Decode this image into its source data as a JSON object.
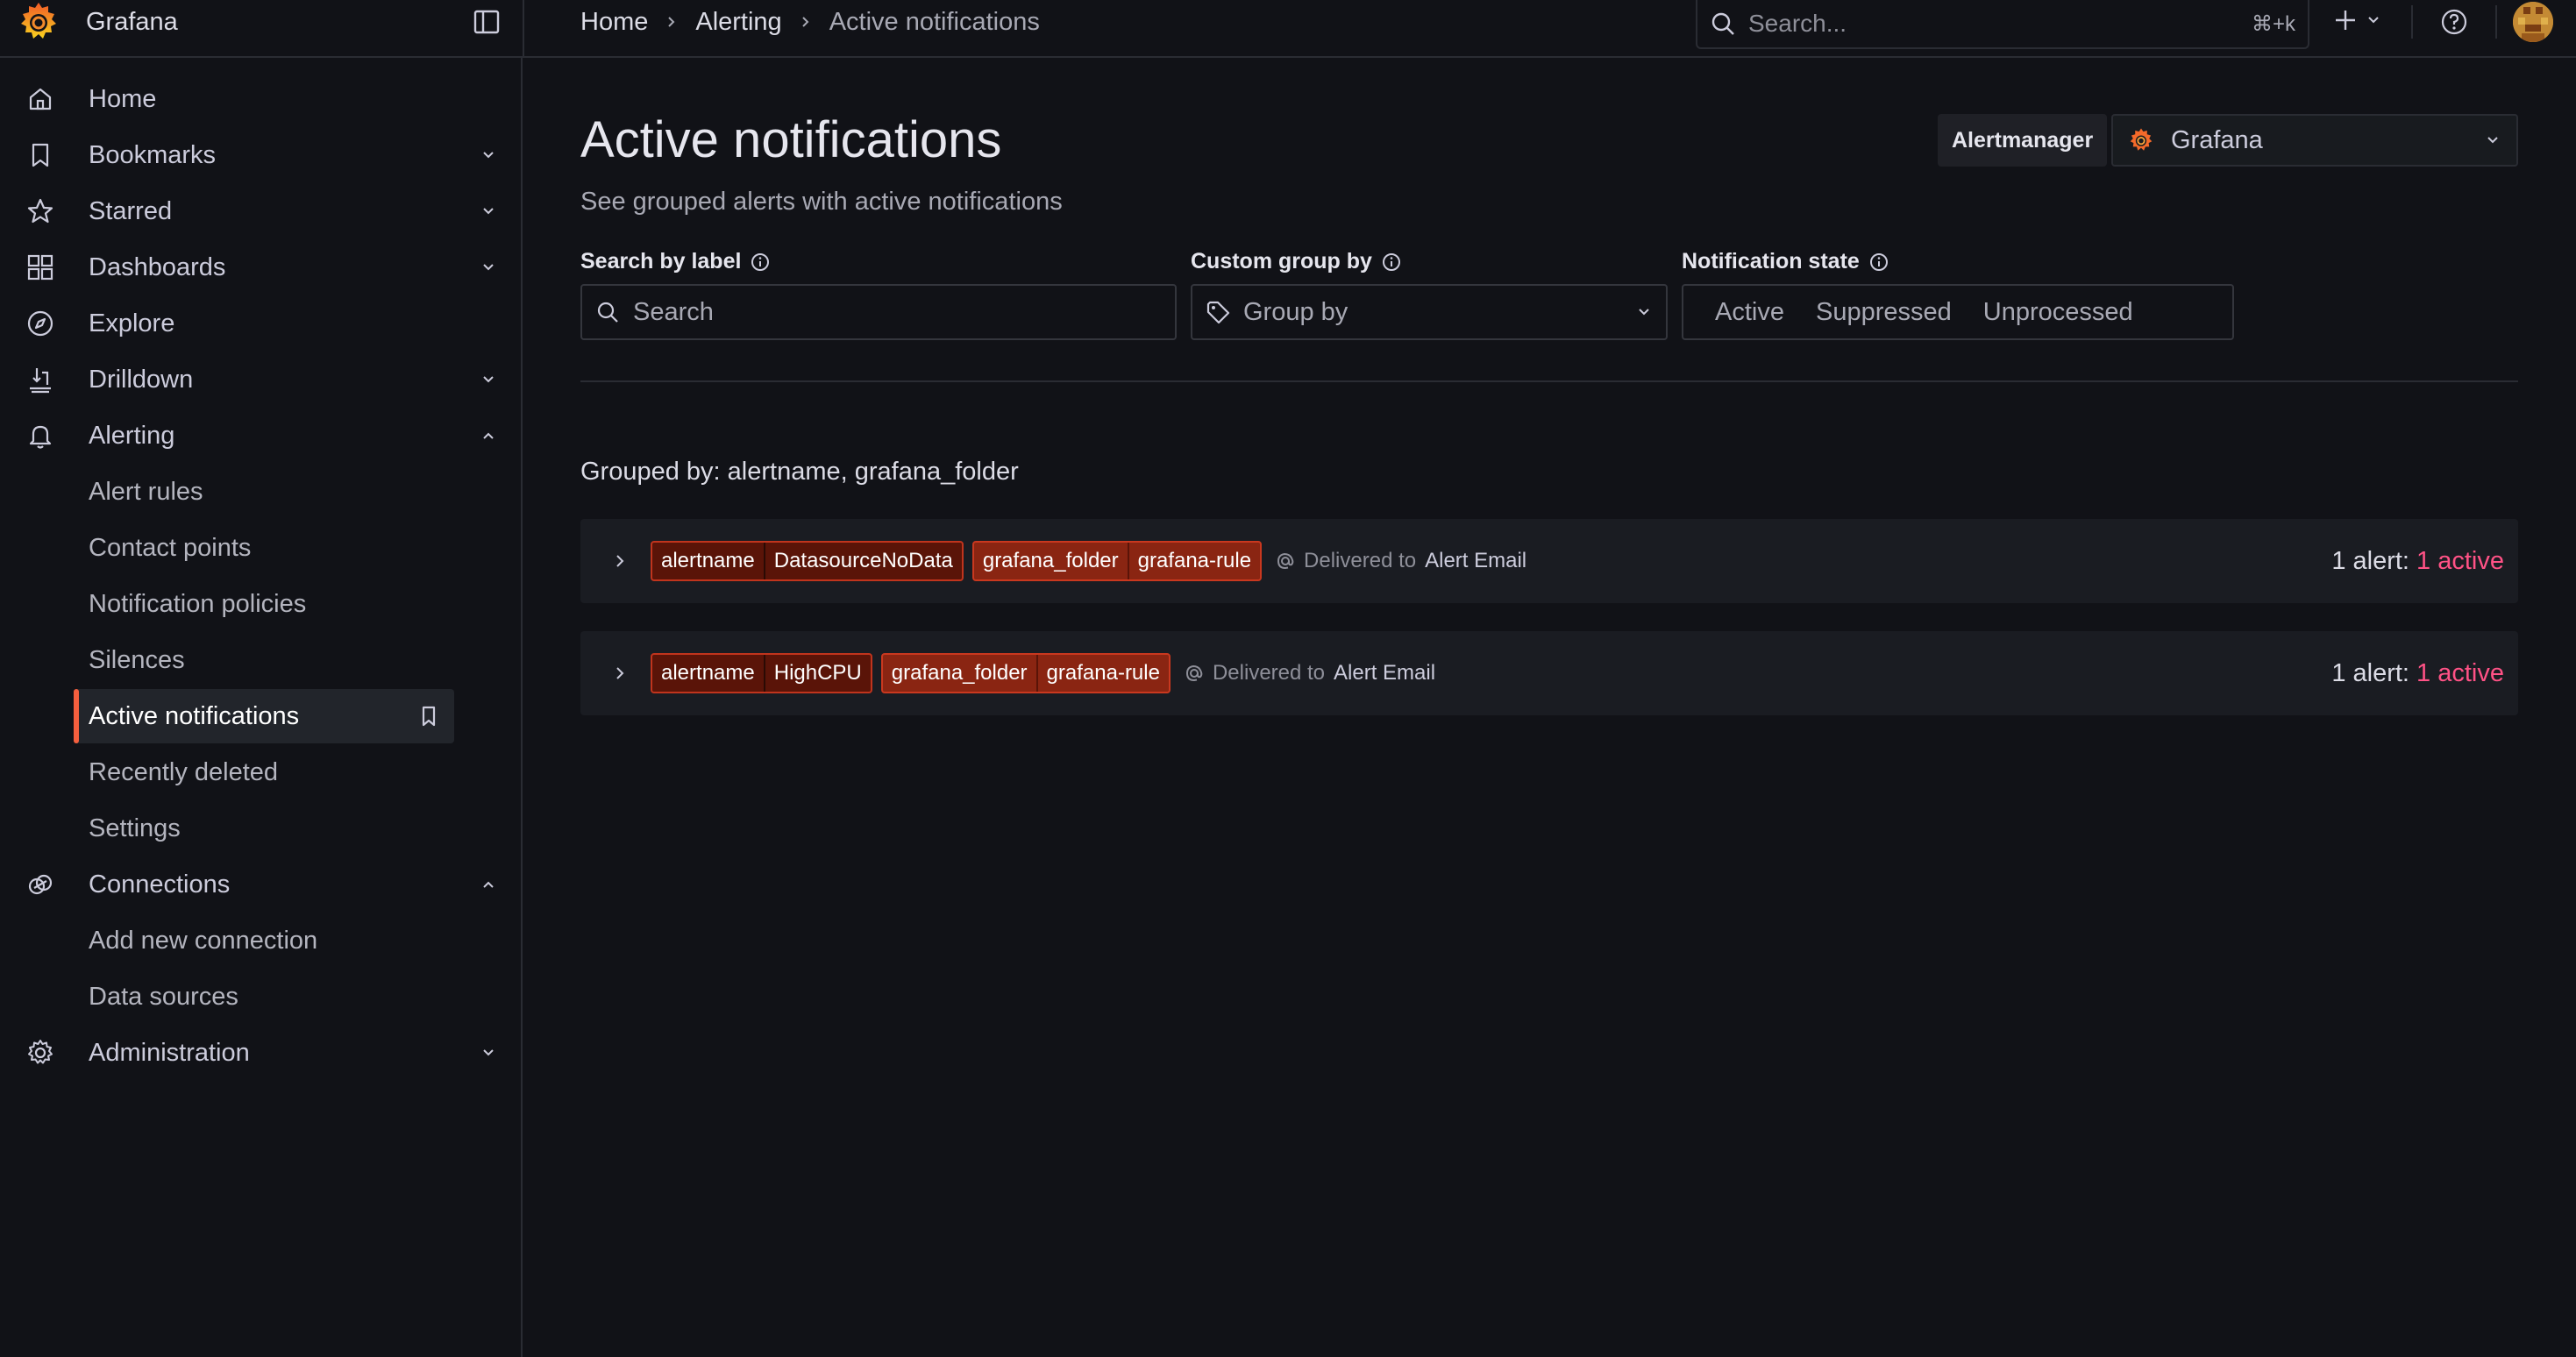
{
  "app": {
    "name": "Grafana",
    "accent_color": "#f55f3e",
    "active_text_color": "#ff5286"
  },
  "topbar": {
    "breadcrumb": [
      {
        "label": "Home"
      },
      {
        "label": "Alerting"
      },
      {
        "label": "Active notifications"
      }
    ],
    "search": {
      "placeholder": "Search...",
      "shortcut": "⌘+k"
    },
    "icons": [
      "grafana-logo-icon",
      "dock-menu-icon",
      "search-icon",
      "plus-icon",
      "help-icon",
      "user-avatar"
    ]
  },
  "sidebar": {
    "items": [
      {
        "label": "Home",
        "icon": "home-icon"
      },
      {
        "label": "Bookmarks",
        "icon": "bookmark-icon",
        "expandable": true
      },
      {
        "label": "Starred",
        "icon": "star-icon",
        "expandable": true
      },
      {
        "label": "Dashboards",
        "icon": "dashboards-icon",
        "expandable": true
      },
      {
        "label": "Explore",
        "icon": "compass-icon"
      },
      {
        "label": "Drilldown",
        "icon": "drilldown-icon",
        "expandable": true
      },
      {
        "label": "Alerting",
        "icon": "bell-icon",
        "expanded": true,
        "children": [
          {
            "label": "Alert rules"
          },
          {
            "label": "Contact points"
          },
          {
            "label": "Notification policies"
          },
          {
            "label": "Silences"
          },
          {
            "label": "Active notifications",
            "active": true
          },
          {
            "label": "Recently deleted"
          },
          {
            "label": "Settings"
          }
        ]
      },
      {
        "label": "Connections",
        "icon": "connections-icon",
        "expanded": true,
        "children": [
          {
            "label": "Add new connection"
          },
          {
            "label": "Data sources"
          }
        ]
      },
      {
        "label": "Administration",
        "icon": "gear-icon",
        "expandable": true
      }
    ]
  },
  "main": {
    "title": "Active notifications",
    "subtitle": "See grouped alerts with active notifications",
    "alertmanager": {
      "label": "Alertmanager",
      "value": "Grafana"
    },
    "filters": {
      "search_label": "Search by label",
      "search_placeholder": "Search",
      "group_label": "Custom group by",
      "group_placeholder": "Group by",
      "state_label": "Notification state",
      "state_options": [
        "Active",
        "Suppressed",
        "Unprocessed"
      ]
    },
    "grouped_by": "Grouped by: alertname, grafana_folder",
    "groups": [
      {
        "tags": [
          {
            "key": "alertname",
            "value": "DatasourceNoData"
          },
          {
            "key": "grafana_folder",
            "value": "grafana-rule"
          }
        ],
        "delivered_prefix": "Delivered to",
        "contact_point": "Alert Email",
        "count_prefix": "1 alert:",
        "count_active": "1 active"
      },
      {
        "tags": [
          {
            "key": "alertname",
            "value": "HighCPU"
          },
          {
            "key": "grafana_folder",
            "value": "grafana-rule"
          }
        ],
        "delivered_prefix": "Delivered to",
        "contact_point": "Alert Email",
        "count_prefix": "1 alert:",
        "count_active": "1 active"
      }
    ]
  }
}
